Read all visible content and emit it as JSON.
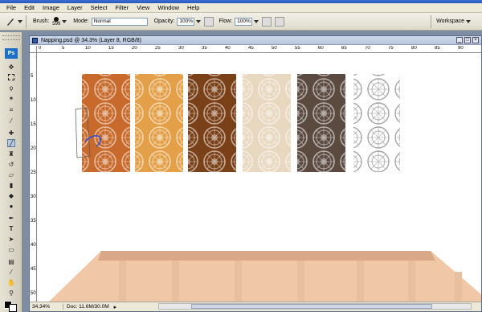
{
  "menu": [
    "File",
    "Edit",
    "Image",
    "Layer",
    "Select",
    "Filter",
    "View",
    "Window",
    "Help"
  ],
  "options": {
    "brush_label": "Brush:",
    "brush_size": "599",
    "mode_label": "Mode:",
    "mode_value": "Normal",
    "opacity_label": "Opacity:",
    "opacity_value": "100%",
    "flow_label": "Flow:",
    "flow_value": "100%",
    "workspace_label": "Workspace"
  },
  "toolbox": {
    "logo": "Ps"
  },
  "document": {
    "title": "Napping.psd @ 34.3% (Layer 8, RGB/8)",
    "zoom": "34.34%",
    "doc_size": "Doc: 11.6M/30.0M",
    "ruler_h": [
      "0",
      "5",
      "10",
      "15",
      "20",
      "25",
      "30",
      "35",
      "40",
      "45",
      "50",
      "55",
      "60",
      "65",
      "70",
      "75",
      "80",
      "85",
      "90"
    ],
    "ruler_v": [
      "5",
      "10",
      "15",
      "20",
      "25",
      "30",
      "35",
      "40",
      "45",
      "50"
    ]
  },
  "colors": {
    "panel_colors": [
      "#c86a2c",
      "#e3a048",
      "#7a4018",
      "#e8d8c0",
      "#5a4a40",
      "#ffffff"
    ],
    "rail_color": "#f0c8a8"
  }
}
